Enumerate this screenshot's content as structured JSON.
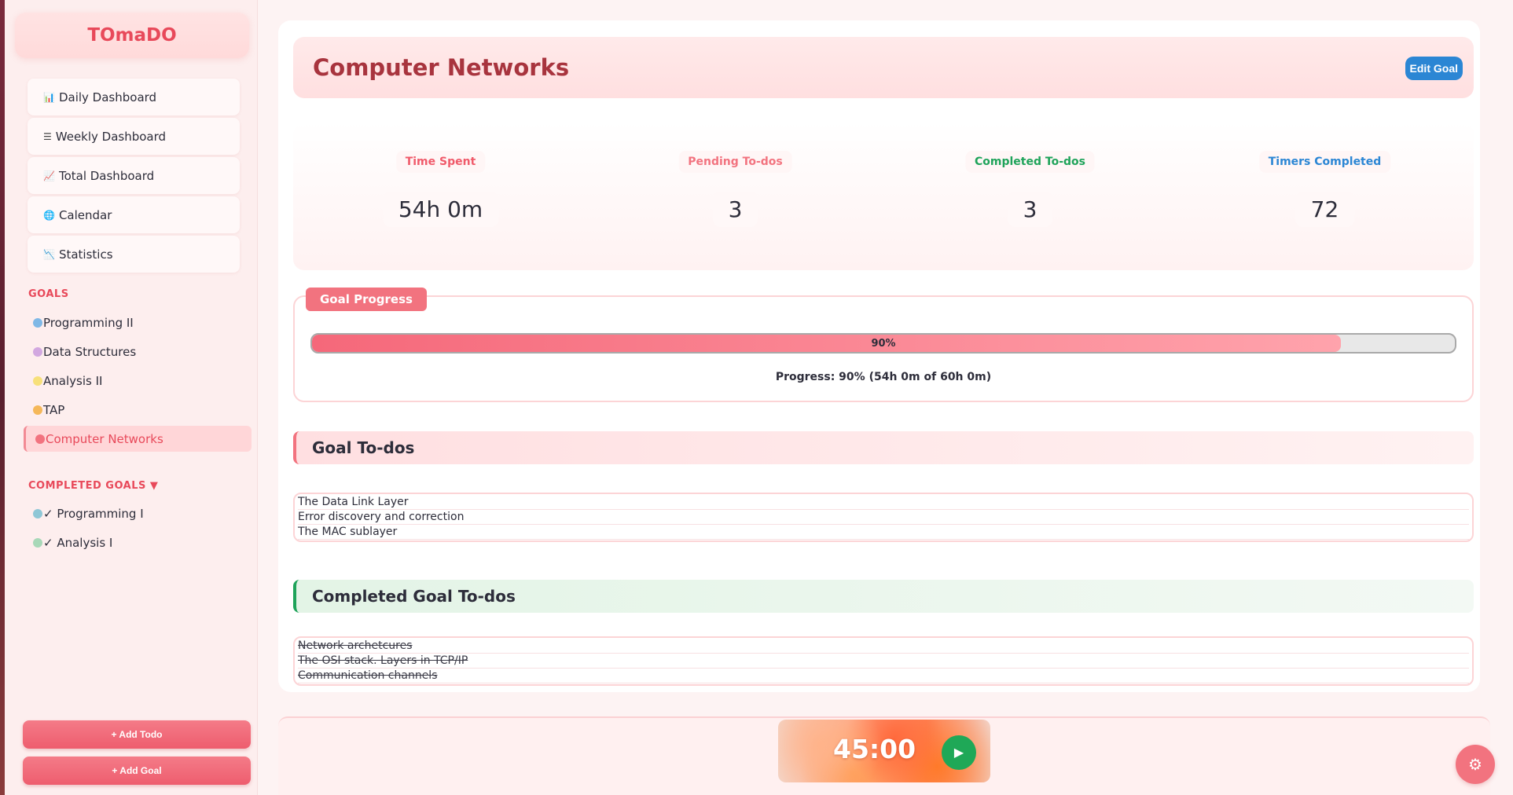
{
  "app": {
    "brand": "TOmaDO"
  },
  "nav": [
    {
      "icon": "📊",
      "label": "Daily Dashboard"
    },
    {
      "icon": "☰",
      "label": "Weekly Dashboard"
    },
    {
      "icon": "📈",
      "label": "Total Dashboard"
    },
    {
      "icon": "🌐",
      "label": "Calendar"
    },
    {
      "icon": "📉",
      "label": "Statistics"
    }
  ],
  "goals": {
    "title": "GOALS",
    "items": [
      {
        "label": "Programming II",
        "color": "#7fb8e6"
      },
      {
        "label": "Data Structures",
        "color": "#d2a8e0"
      },
      {
        "label": "Analysis II",
        "color": "#f7e07a"
      },
      {
        "label": "TAP",
        "color": "#f5b85a"
      },
      {
        "label": "Computer Networks",
        "color": "#f2737f"
      }
    ]
  },
  "completed_goals": {
    "title": "COMPLETED GOALS ▼",
    "items": [
      {
        "label": "✓ Programming I",
        "color": "#8fc7d6"
      },
      {
        "label": "✓ Analysis I",
        "color": "#a8d8b8"
      }
    ]
  },
  "sidebar_buttons": {
    "add_todo": "+ Add Todo",
    "add_goal": "+ Add Goal"
  },
  "page": {
    "title": "Computer Networks",
    "edit_label": "Edit Goal"
  },
  "stats": [
    {
      "label": "Time Spent",
      "value": "54h 0m",
      "color": "#f05a6a"
    },
    {
      "label": "Pending To-dos",
      "value": "3",
      "color": "#f2737f"
    },
    {
      "label": "Completed To-dos",
      "value": "3",
      "color": "#1fa35a"
    },
    {
      "label": "Timers Completed",
      "value": "72",
      "color": "#2b86d4"
    }
  ],
  "progress": {
    "badge": "Goal Progress",
    "percent": 90,
    "percent_label": "90%",
    "text": "Progress: 90% (54h 0m of 60h 0m)"
  },
  "todos": {
    "title": "Goal To-dos",
    "items": [
      "The Data Link Layer",
      "Error discovery and correction",
      "The MAC sublayer"
    ]
  },
  "completed_todos": {
    "title": "Completed Goal To-dos",
    "items": [
      "Network archetcures",
      "The OSI stack. Layers in TCP/IP",
      "Communication channels"
    ]
  },
  "timer": {
    "time": "45:00",
    "play_icon": "play-icon"
  },
  "settings": {
    "icon": "gear-icon"
  }
}
